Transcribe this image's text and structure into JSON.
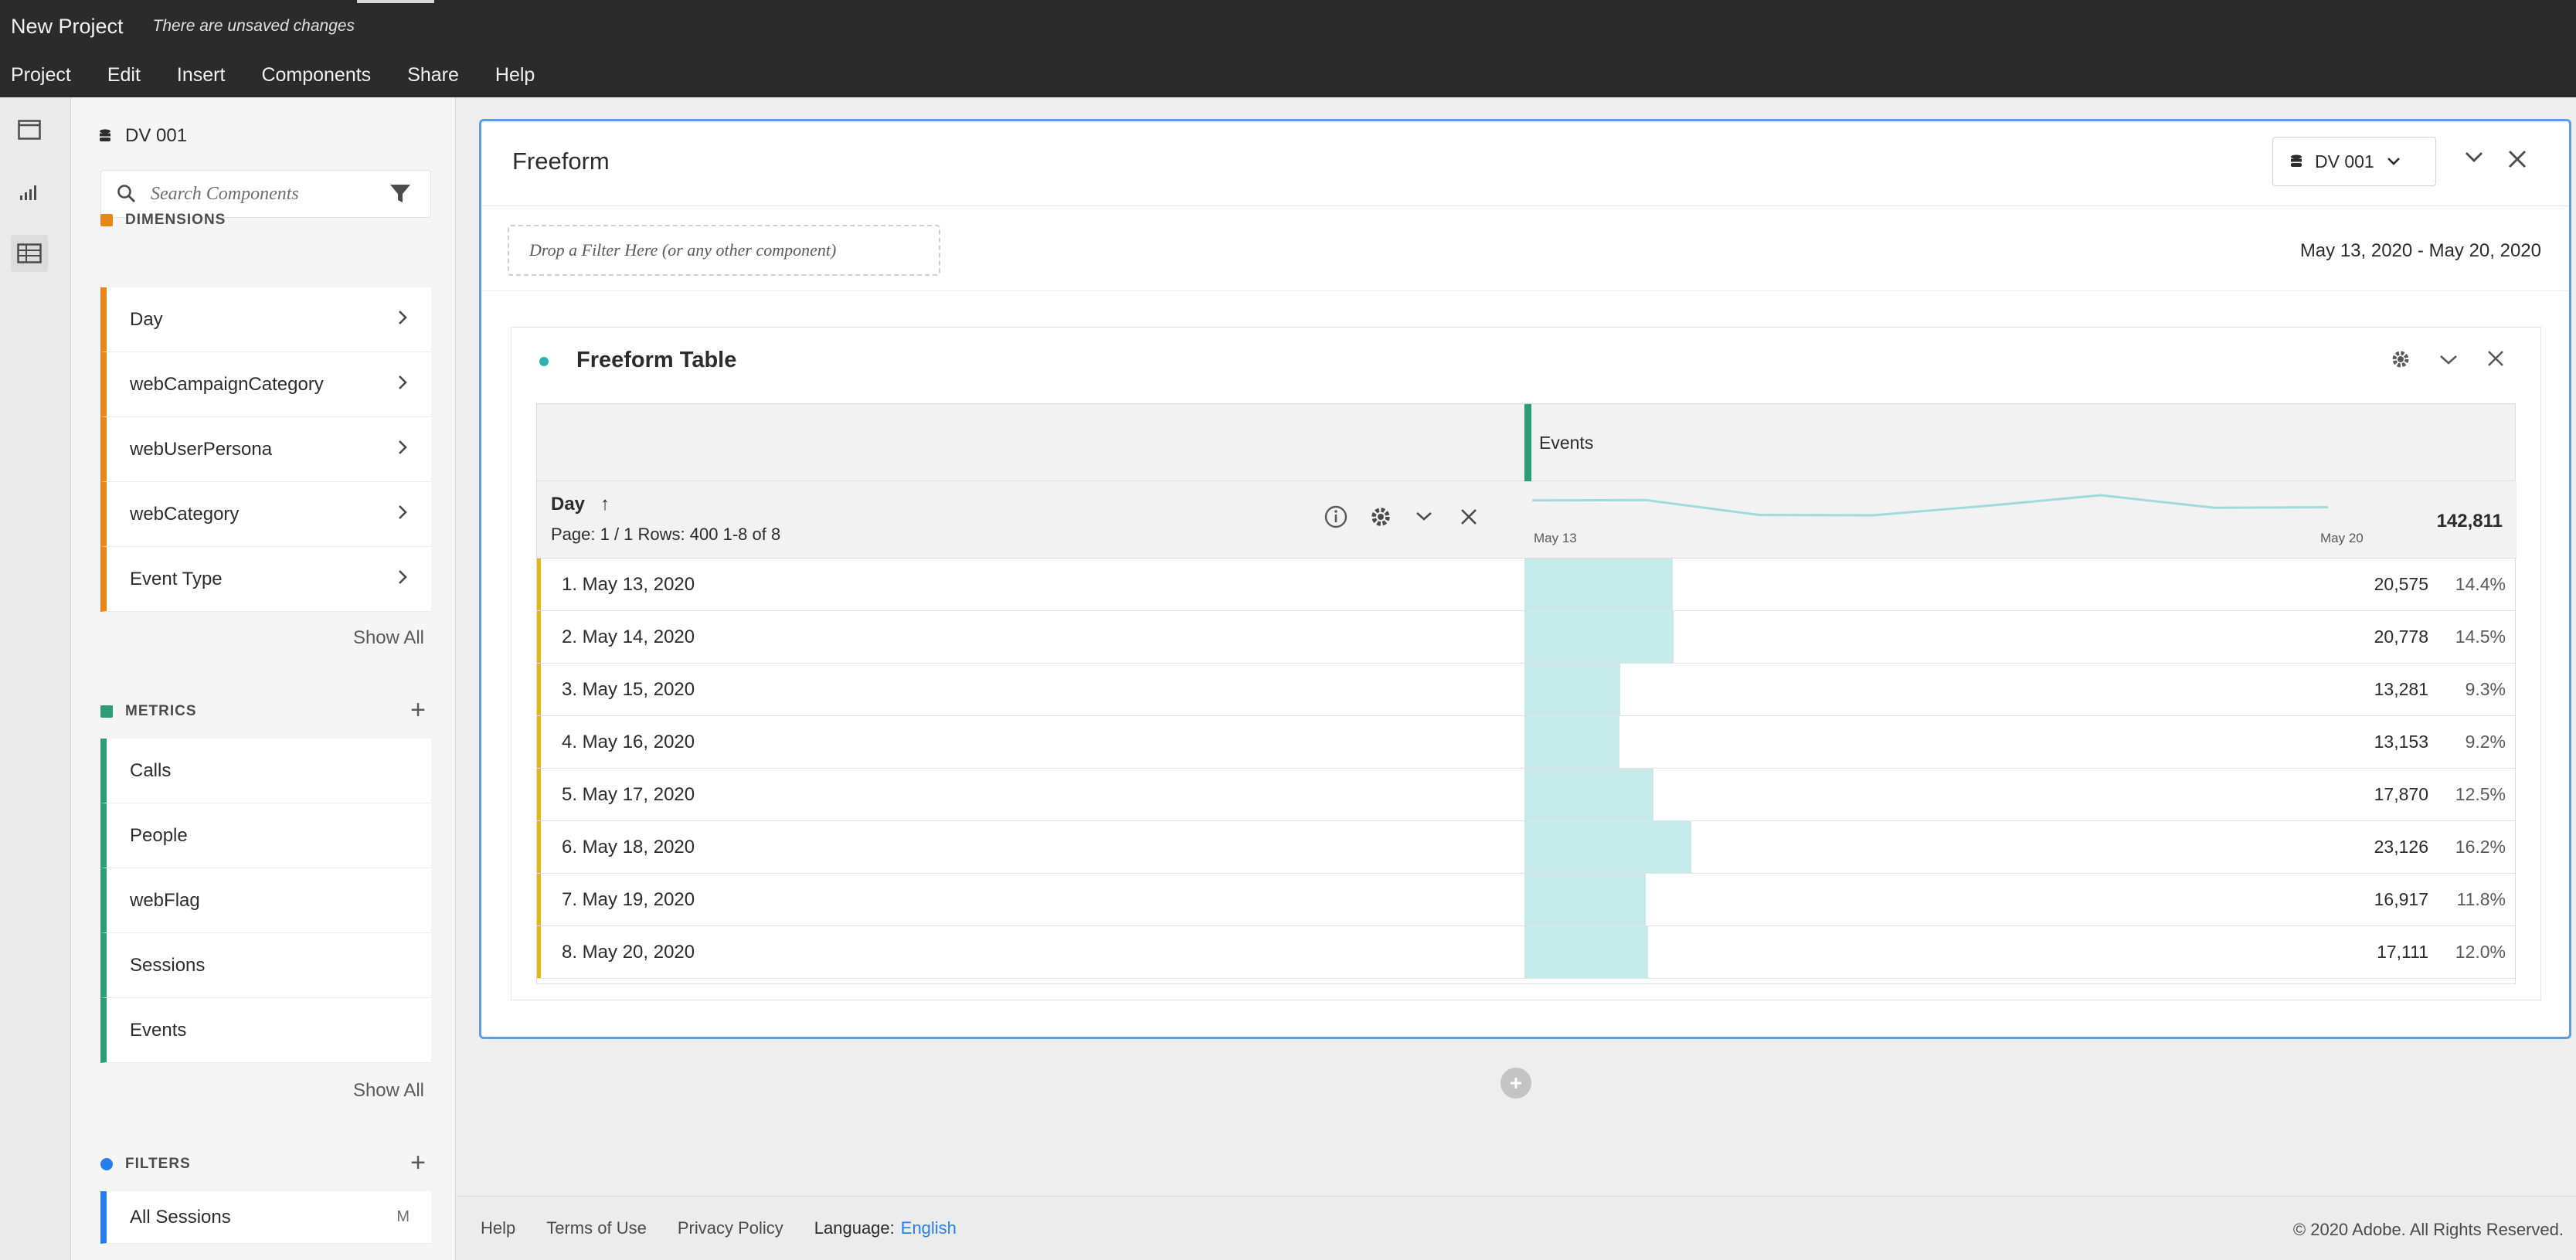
{
  "app": {
    "title": "New Project",
    "unsaved_note": "There are unsaved changes"
  },
  "menu": [
    "Project",
    "Edit",
    "Insert",
    "Components",
    "Share",
    "Help"
  ],
  "rail": [
    {
      "icon": "panel-icon"
    },
    {
      "icon": "visualization-icon"
    },
    {
      "icon": "components-icon",
      "active": true
    }
  ],
  "panel": {
    "data_view": "DV 001",
    "search_placeholder": "Search Components",
    "dimensions": {
      "heading": "DIMENSIONS",
      "color": "#e68619",
      "items": [
        "Day",
        "webCampaignCategory",
        "webUserPersona",
        "webCategory",
        "Event Type"
      ],
      "show_all": "Show All"
    },
    "metrics": {
      "heading": "METRICS",
      "color": "#2d9d78",
      "items": [
        "Calls",
        "People",
        "webFlag",
        "Sessions",
        "Events"
      ],
      "show_all": "Show All"
    },
    "filters": {
      "heading": "FILTERS",
      "color": "#2680eb",
      "items": [
        {
          "label": "All Sessions",
          "tag": "M"
        }
      ]
    }
  },
  "freeform": {
    "title": "Freeform",
    "data_view": "DV 001",
    "drop_zone": "Drop a Filter Here (or any other component)",
    "date_range": "May 13, 2020 - May 20, 2020"
  },
  "table": {
    "title": "Freeform Table",
    "metric": "Events",
    "dimension": "Day",
    "page_info": "Page: 1 / 1 Rows:  400   1-8 of 8",
    "spark_start": "May 13",
    "spark_end": "May 20",
    "total": "142,811",
    "rows": [
      {
        "label": "1. May 13, 2020",
        "value": "20,575",
        "pct": "14.4%",
        "share": 0.144
      },
      {
        "label": "2. May 14, 2020",
        "value": "20,778",
        "pct": "14.5%",
        "share": 0.145
      },
      {
        "label": "3. May 15, 2020",
        "value": "13,281",
        "pct": "9.3%",
        "share": 0.093
      },
      {
        "label": "4. May 16, 2020",
        "value": "13,153",
        "pct": "9.2%",
        "share": 0.092
      },
      {
        "label": "5. May 17, 2020",
        "value": "17,870",
        "pct": "12.5%",
        "share": 0.125
      },
      {
        "label": "6. May 18, 2020",
        "value": "23,126",
        "pct": "16.2%",
        "share": 0.162
      },
      {
        "label": "7. May 19, 2020",
        "value": "16,917",
        "pct": "11.8%",
        "share": 0.118
      },
      {
        "label": "8. May 20, 2020",
        "value": "17,111",
        "pct": "12.0%",
        "share": 0.12
      }
    ],
    "accent": "#2d9d78",
    "bar_color": "#c7ebeb",
    "row_marker_color": "#e2b714"
  },
  "footer": {
    "links": [
      "Help",
      "Terms of Use",
      "Privacy Policy"
    ],
    "language_label": "Language:",
    "language": "English",
    "copyright": "© 2020 Adobe. All Rights Reserved."
  }
}
